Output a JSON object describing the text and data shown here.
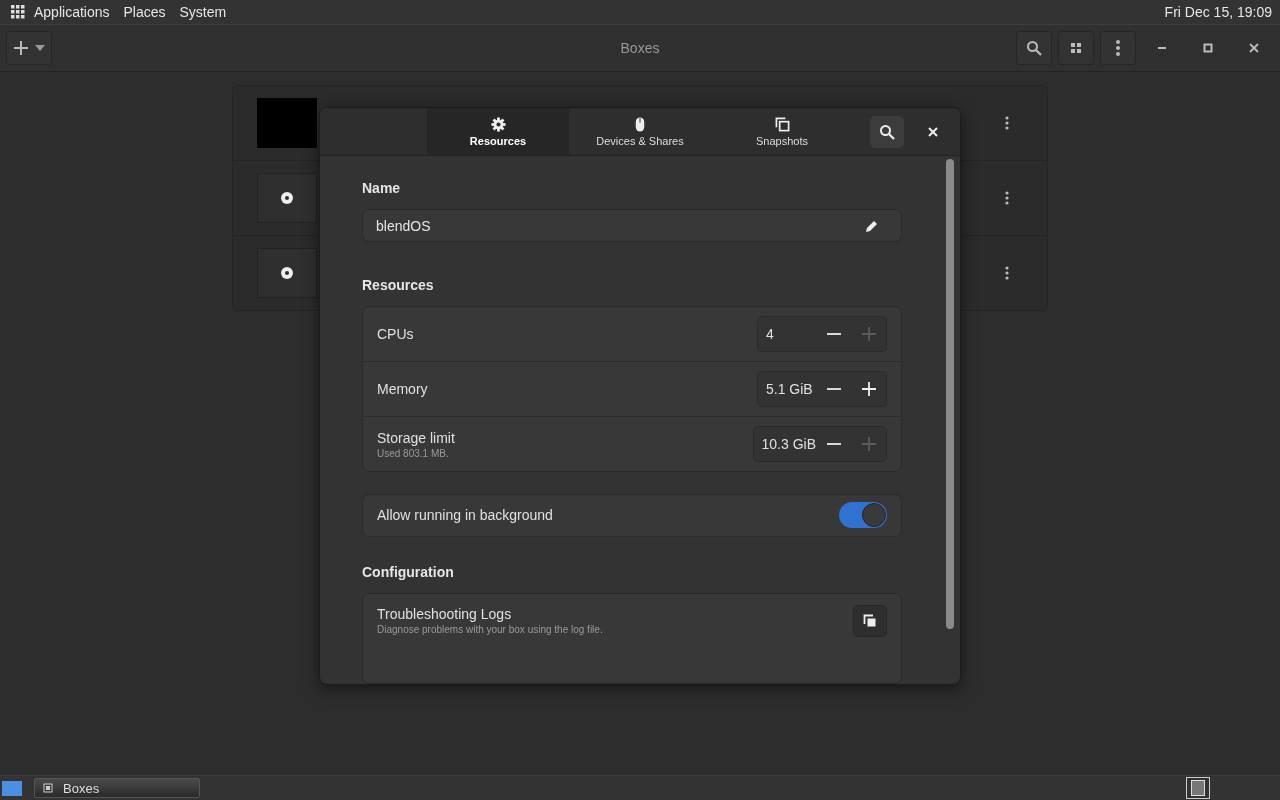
{
  "top_panel": {
    "menus": [
      "Applications",
      "Places",
      "System"
    ],
    "clock": "Fri Dec 15, 19:09"
  },
  "window": {
    "title": "Boxes"
  },
  "boxes": [
    {
      "kind": "screen"
    },
    {
      "kind": "disc"
    },
    {
      "kind": "disc"
    }
  ],
  "dialog": {
    "tabs": [
      {
        "label": "Resources",
        "kind": "gear",
        "selected": true
      },
      {
        "label": "Devices & Shares",
        "kind": "mouse",
        "selected": false
      },
      {
        "label": "Snapshots",
        "kind": "copy",
        "selected": false
      }
    ],
    "name": {
      "heading": "Name",
      "value": "blendOS"
    },
    "resources": {
      "heading": "Resources",
      "rows": [
        {
          "label": "CPUs",
          "value": "4",
          "minus_disabled": false,
          "plus_disabled": true
        },
        {
          "label": "Memory",
          "value": "5.1 GiB",
          "minus_disabled": false,
          "plus_disabled": false
        },
        {
          "label": "Storage limit",
          "sublabel": "Used 803.1 MB.",
          "value": "10.3 GiB",
          "minus_disabled": false,
          "plus_disabled": true
        }
      ]
    },
    "background": {
      "label": "Allow running in background",
      "on": true
    },
    "configuration": {
      "heading": "Configuration",
      "rows": [
        {
          "title": "Troubleshooting Logs",
          "subtitle": "Diagnose problems with your box using the log file."
        }
      ]
    }
  },
  "taskbar": {
    "task": "Boxes"
  }
}
